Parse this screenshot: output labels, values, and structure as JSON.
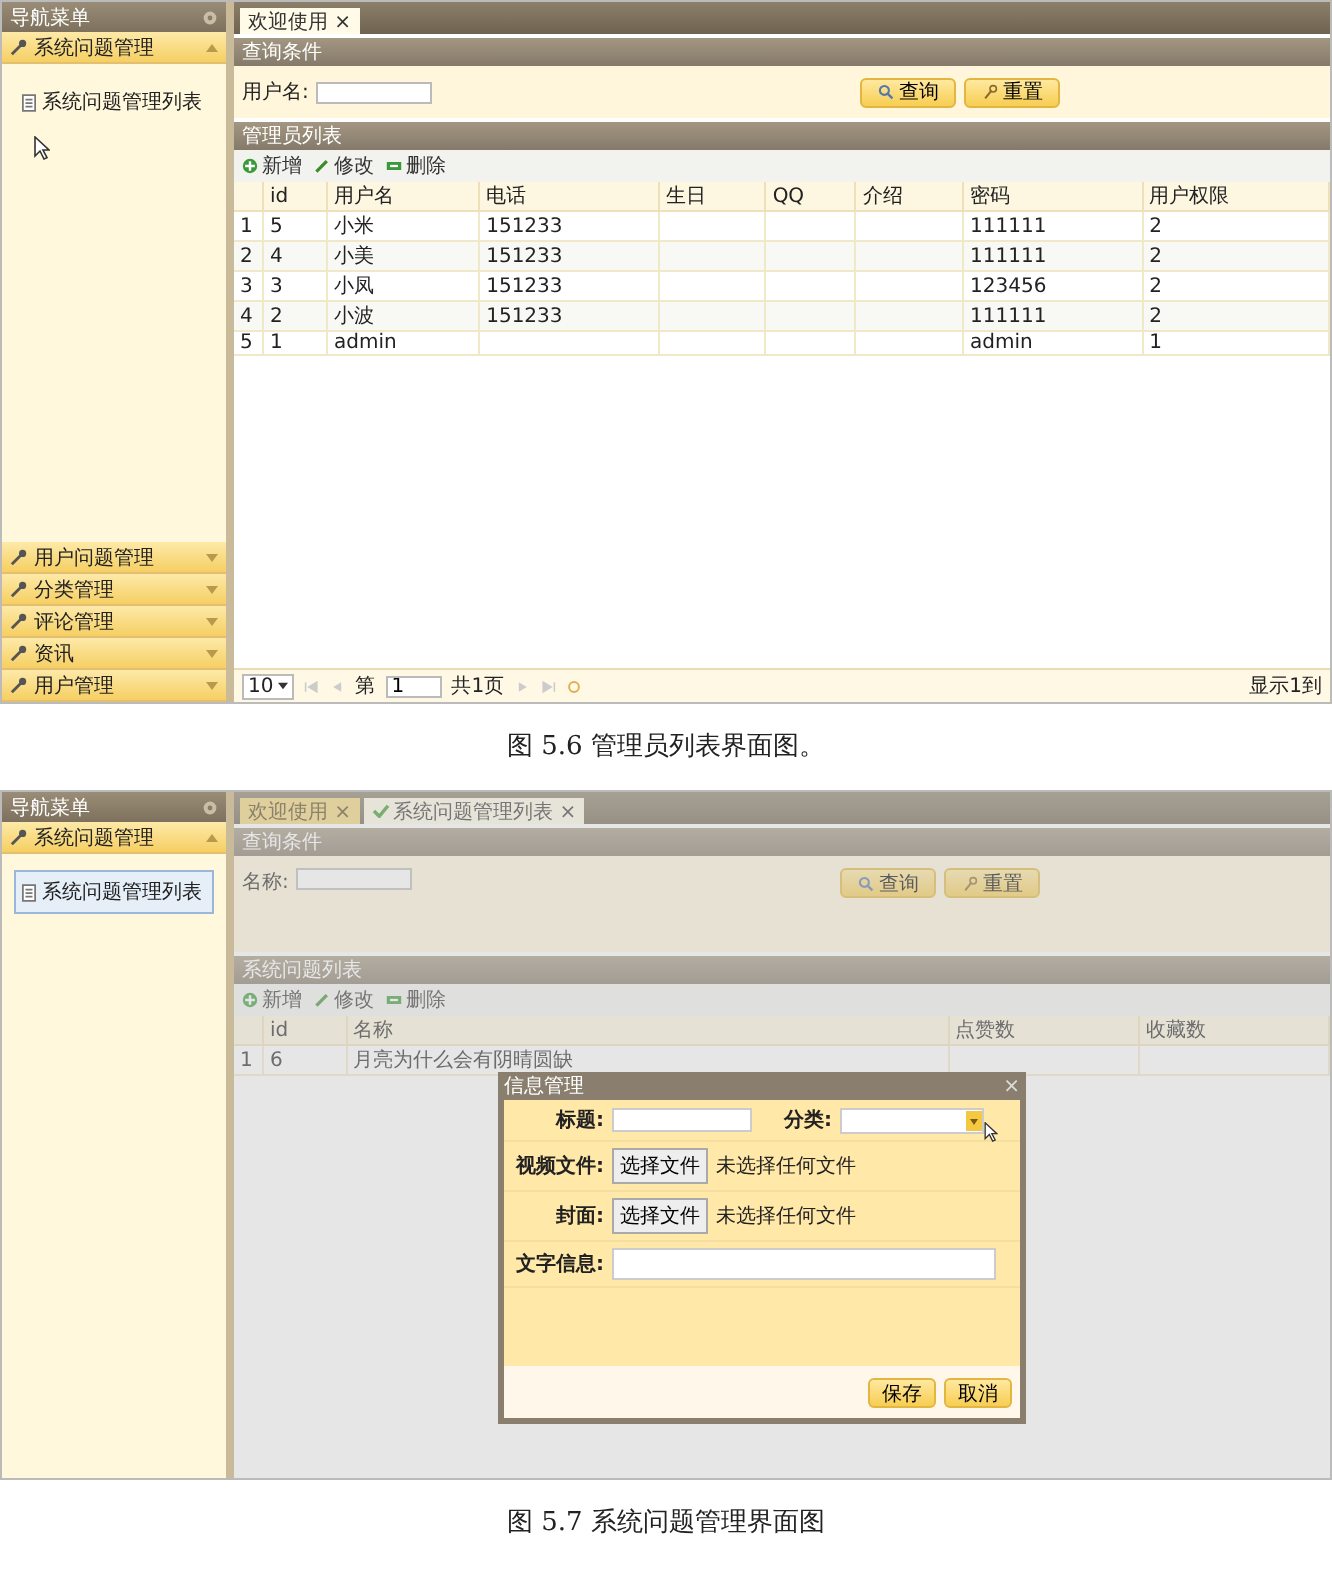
{
  "figures": [
    {
      "screen": {
        "sidebar": {
          "title": "导航菜单",
          "cursor": true,
          "panels": [
            {
              "label": "系统问题管理",
              "expanded": true,
              "items": [
                {
                  "label": "系统问题管理列表",
                  "selected": false
                }
              ]
            },
            {
              "label": "用户问题管理",
              "expanded": false
            },
            {
              "label": "分类管理",
              "expanded": false
            },
            {
              "label": "评论管理",
              "expanded": false
            },
            {
              "label": "资讯",
              "expanded": false
            },
            {
              "label": "用户管理",
              "expanded": false
            }
          ]
        },
        "tabs": [
          {
            "label": "欢迎使用",
            "close": "×",
            "kind": "plain",
            "selected": true
          }
        ],
        "query": {
          "title": "查询条件",
          "fields": [
            {
              "label": "用户名:"
            }
          ],
          "buttons": [
            {
              "label": "查询",
              "kind": "search"
            },
            {
              "label": "重置",
              "kind": "reset"
            }
          ]
        },
        "list": {
          "title": "管理员列表",
          "tools": [
            {
              "label": "新增",
              "kind": "add"
            },
            {
              "label": "修改",
              "kind": "edit"
            },
            {
              "label": "删除",
              "kind": "delete"
            }
          ],
          "columns": [
            "id",
            "用户名",
            "电话",
            "生日",
            "QQ",
            "介绍",
            "密码",
            "用户权限"
          ],
          "rows": [
            {
              "number": "1",
              "cells": [
                "5",
                "小米",
                "151233",
                null,
                null,
                null,
                "111111",
                "2"
              ]
            },
            {
              "number": "2",
              "cells": [
                "4",
                "小美",
                "151233",
                null,
                null,
                null,
                "111111",
                "2"
              ]
            },
            {
              "number": "3",
              "cells": [
                "3",
                "小凤",
                "151233",
                null,
                null,
                null,
                "123456",
                "2"
              ]
            },
            {
              "number": "4",
              "cells": [
                "2",
                "小波",
                "151233",
                null,
                null,
                null,
                "111111",
                "2"
              ]
            },
            {
              "number": "5",
              "cells": [
                "1",
                "admin",
                null,
                null,
                null,
                null,
                "admin",
                "1"
              ]
            }
          ]
        },
        "pager": {
          "page_size": "10",
          "page_label": "第",
          "page": "1",
          "total": "共1页",
          "display": "显示1到"
        }
      },
      "caption": "图 5.6 管理员列表界面图。"
    },
    {
      "screen": {
        "sidebar": {
          "title": "导航菜单",
          "cursor": false,
          "panels": [
            {
              "label": "系统问题管理",
              "expanded": true,
              "items": [
                {
                  "label": "系统问题管理列表",
                  "selected": true
                }
              ]
            }
          ]
        },
        "tabs": [
          {
            "label": "欢迎使用",
            "close": "×",
            "kind": "plain",
            "selected": false
          },
          {
            "label": "系统问题管理列表",
            "close": "×",
            "kind": "page",
            "selected": true
          }
        ],
        "query": {
          "title": "查询条件",
          "fields": [
            {
              "label": "名称:"
            }
          ],
          "buttons": [
            {
              "label": "查询",
              "kind": "search"
            },
            {
              "label": "重置",
              "kind": "reset"
            }
          ]
        },
        "list": {
          "title": "系统问题列表",
          "tools": [
            {
              "label": "新增",
              "kind": "add"
            },
            {
              "label": "修改",
              "kind": "edit"
            },
            {
              "label": "删除",
              "kind": "delete"
            }
          ],
          "columns": [
            "id",
            "名称",
            "点赞数",
            "收藏数"
          ],
          "rows": [
            {
              "number": "1",
              "cells": [
                "6",
                "月亮为什么会有阴晴圆缺",
                null,
                null
              ]
            }
          ]
        },
        "dialog": {
          "title": "信息管理",
          "close": "×",
          "rows": [
            {
              "fields": [
                {
                  "kind": "text",
                  "label": "标题:"
                },
                {
                  "kind": "select",
                  "label": "分类:",
                  "cursor": true
                }
              ]
            },
            {
              "fields": [
                {
                  "kind": "file",
                  "label": "视频文件:",
                  "button": "选择文件",
                  "status": "未选择任何文件"
                }
              ]
            },
            {
              "fields": [
                {
                  "kind": "file",
                  "label": "封面:",
                  "button": "选择文件",
                  "status": "未选择任何文件"
                }
              ]
            },
            {
              "fields": [
                {
                  "kind": "textarea",
                  "label": "文字信息:"
                }
              ]
            }
          ],
          "buttons": [
            "保存",
            "取消"
          ]
        }
      },
      "caption": "图 5.7 系统问题管理界面图"
    }
  ]
}
